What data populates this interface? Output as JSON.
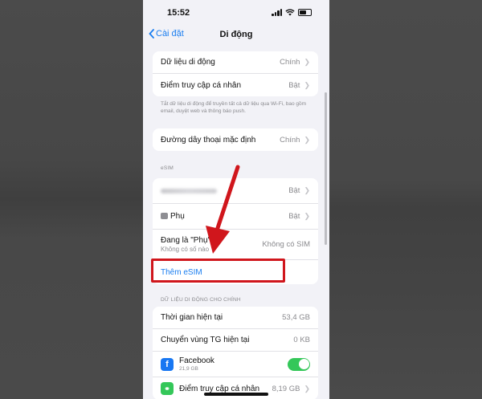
{
  "status_bar": {
    "time": "15:52"
  },
  "nav": {
    "back_label": "Cài đặt",
    "title": "Di động"
  },
  "group1": {
    "rows": [
      {
        "label": "Dữ liệu di động",
        "value": "Chính"
      },
      {
        "label": "Điểm truy cập cá nhân",
        "value": "Bật"
      }
    ],
    "note": "Tắt dữ liệu di động để truyền tất cả dữ liệu qua Wi-Fi, bao gồm email, duyệt web và thông báo push."
  },
  "group2": {
    "rows": [
      {
        "label": "Đường dây thoại mặc định",
        "value": "Chính"
      }
    ]
  },
  "esim": {
    "header": "eSIM",
    "row1_value": "Bật",
    "row2": {
      "label": "Phụ",
      "value": "Bật"
    },
    "row3": {
      "label": "Đang là \"Phụ\"",
      "sublabel": "Không có số nào",
      "value": "Không có SIM"
    },
    "add_esim": "Thêm eSIM"
  },
  "usage": {
    "header": "DỮ LIỆU DI ĐỘNG CHO CHÍNH",
    "rows": [
      {
        "label": "Thời gian hiện tại",
        "value": "53,4 GB"
      },
      {
        "label": "Chuyển vùng TG hiện tại",
        "value": "0 KB"
      }
    ],
    "facebook": {
      "label": "Facebook",
      "size": "21,9 GB",
      "enabled": true
    },
    "hotspot": {
      "label": "Điểm truy cập cá nhân",
      "value": "8,19 GB"
    }
  },
  "colors": {
    "accent": "#1a7ef0",
    "toggle_on": "#34c759",
    "annotation_red": "#d0161c",
    "facebook_blue": "#1877f2"
  }
}
